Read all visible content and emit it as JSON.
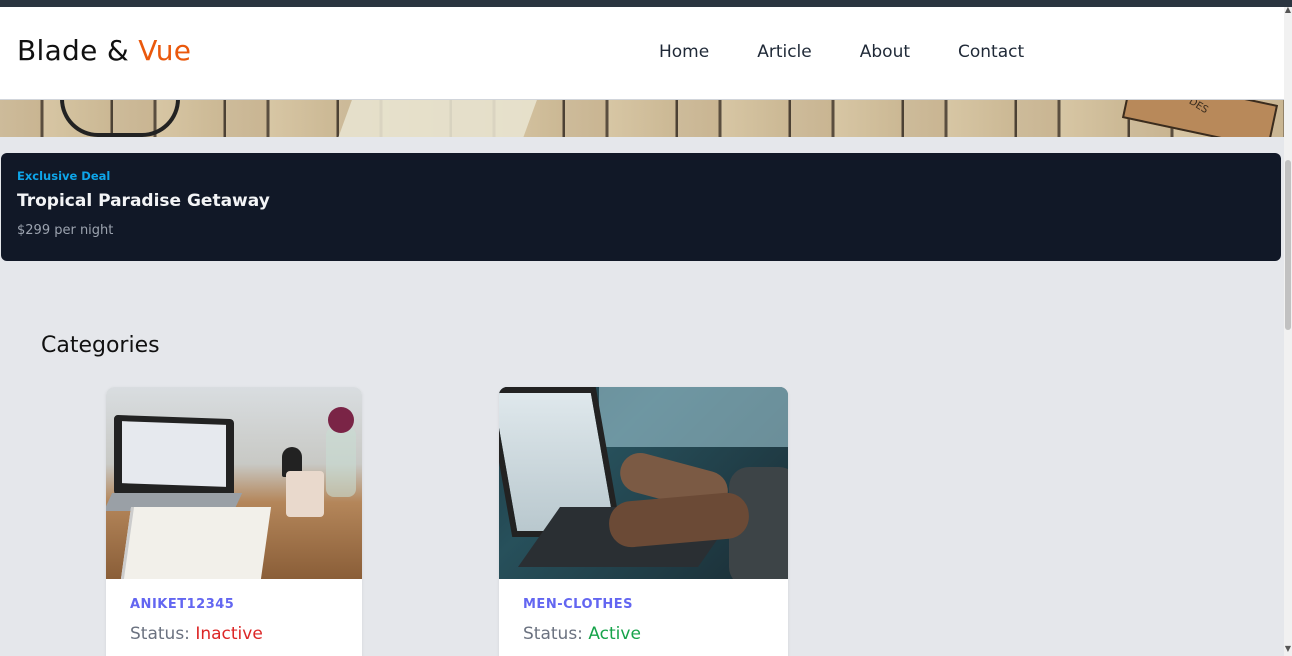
{
  "brand": {
    "name": "Blade & ",
    "accent": "Vue"
  },
  "nav": {
    "items": [
      "Home",
      "Article",
      "About",
      "Contact"
    ]
  },
  "hero": {
    "book_text": "DES"
  },
  "deal": {
    "tag": "Exclusive Deal",
    "title": "Tropical Paradise Getaway",
    "price": "$299 per night"
  },
  "categories": {
    "title": "Categories",
    "items": [
      {
        "name": "ANIKET12345",
        "status_label": "Status:",
        "status": "Inactive",
        "status_color": "#dc2626"
      },
      {
        "name": "MEN-CLOTHES",
        "status_label": "Status:",
        "status": "Active",
        "status_color": "#16a34a"
      }
    ]
  },
  "colors": {
    "accent": "#ea580c",
    "deal_bg": "#111827",
    "deal_tag": "#0ea5e9",
    "category_name": "#6366f1"
  }
}
